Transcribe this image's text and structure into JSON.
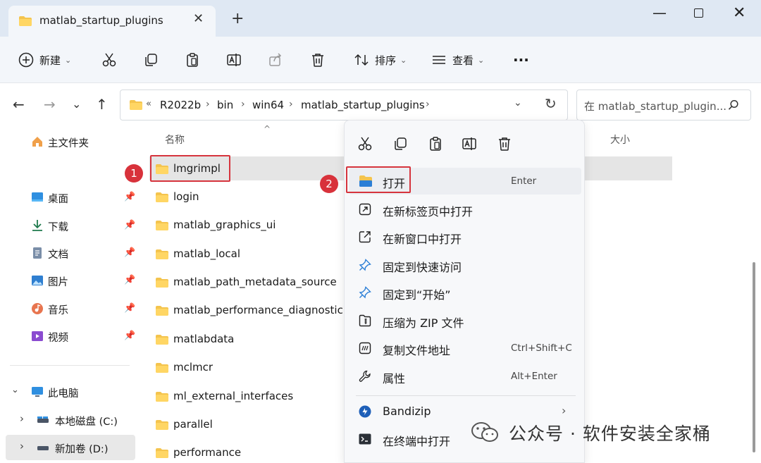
{
  "window": {
    "tab_title": "matlab_startup_plugins",
    "new_tab": "+"
  },
  "toolbar": {
    "new_label": "新建",
    "sort_label": "排序",
    "view_label": "查看",
    "more": "···"
  },
  "address": {
    "overflow": "«",
    "crumbs": [
      "R2022b",
      "bin",
      "win64",
      "matlab_startup_plugins"
    ],
    "search_placeholder": "在 matlab_startup_plugin..."
  },
  "sidebar": {
    "home": "主文件夹",
    "pinned": [
      "桌面",
      "下载",
      "文档",
      "图片",
      "音乐",
      "视频"
    ],
    "this_pc": "此电脑",
    "drives": [
      "本地磁盘 (C:)",
      "新加卷 (D:)"
    ]
  },
  "file_list": {
    "col_name": "名称",
    "col_size": "大小",
    "files": [
      "lmgrimpl",
      "login",
      "matlab_graphics_ui",
      "matlab_local",
      "matlab_path_metadata_source",
      "matlab_performance_diagnostic",
      "matlabdata",
      "mclmcr",
      "ml_external_interfaces",
      "parallel",
      "performance"
    ]
  },
  "context_menu": {
    "items": [
      {
        "label": "打开",
        "shortcut": "Enter"
      },
      {
        "label": "在新标签页中打开",
        "shortcut": ""
      },
      {
        "label": "在新窗口中打开",
        "shortcut": ""
      },
      {
        "label": "固定到快速访问",
        "shortcut": ""
      },
      {
        "label": "固定到“开始”",
        "shortcut": ""
      },
      {
        "label": "压缩为 ZIP 文件",
        "shortcut": ""
      },
      {
        "label": "复制文件地址",
        "shortcut": "Ctrl+Shift+C"
      },
      {
        "label": "属性",
        "shortcut": "Alt+Enter"
      },
      {
        "label": "Bandizip",
        "shortcut": ""
      },
      {
        "label": "在终端中打开",
        "shortcut": ""
      }
    ]
  },
  "annotations": {
    "marker1": "1",
    "marker2": "2"
  },
  "watermark": "公众号 · 软件安装全家桶",
  "colors": {
    "accent": "#0067c0",
    "annotation_red": "#d6343d",
    "folder": "#f4c44e"
  }
}
